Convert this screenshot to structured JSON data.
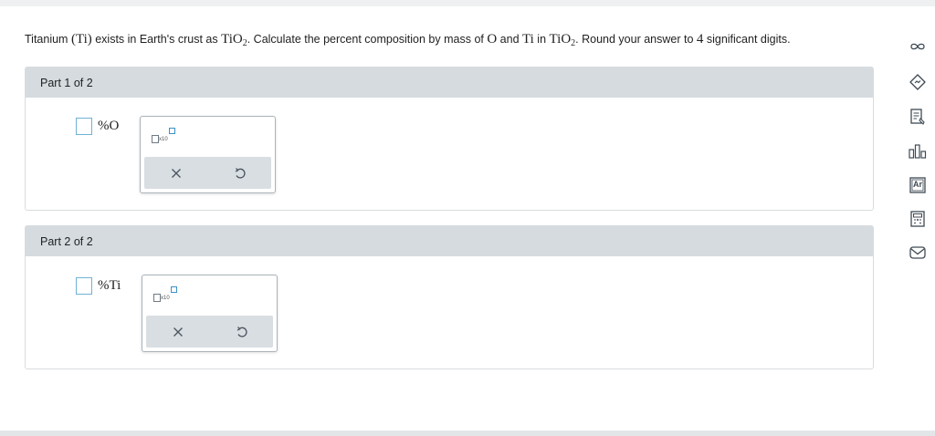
{
  "question": {
    "p1": "Titanium ",
    "ti_sym": "(Ti)",
    "p2": " exists in Earth's crust as ",
    "formula_base": "TiO",
    "formula_sub": "2",
    "p3": ". Calculate the percent composition by mass of ",
    "o_sym": "O",
    "p4": " and ",
    "ti_sym2": "Ti",
    "p5": " in ",
    "formula2_base": "TiO",
    "formula2_sub": "2",
    "p6": ". Round your answer to ",
    "digits": "4",
    "p7": " significant digits."
  },
  "parts": [
    {
      "header": "Part 1 of 2",
      "unit": "%O",
      "value": "",
      "x10_label": "x10"
    },
    {
      "header": "Part 2 of 2",
      "unit": "%Ti",
      "value": "",
      "x10_label": "x10"
    }
  ],
  "sidebar": {
    "icons": [
      "infinity-icon",
      "explanation-icon",
      "notes-icon",
      "data-chart-icon",
      "periodic-table-icon",
      "calculator-icon",
      "mail-icon"
    ],
    "ptable_label": "Ar"
  },
  "colors": {
    "accent": "#3b90c6",
    "header_bg": "#d5dbdf",
    "border": "#d8dcdf"
  }
}
